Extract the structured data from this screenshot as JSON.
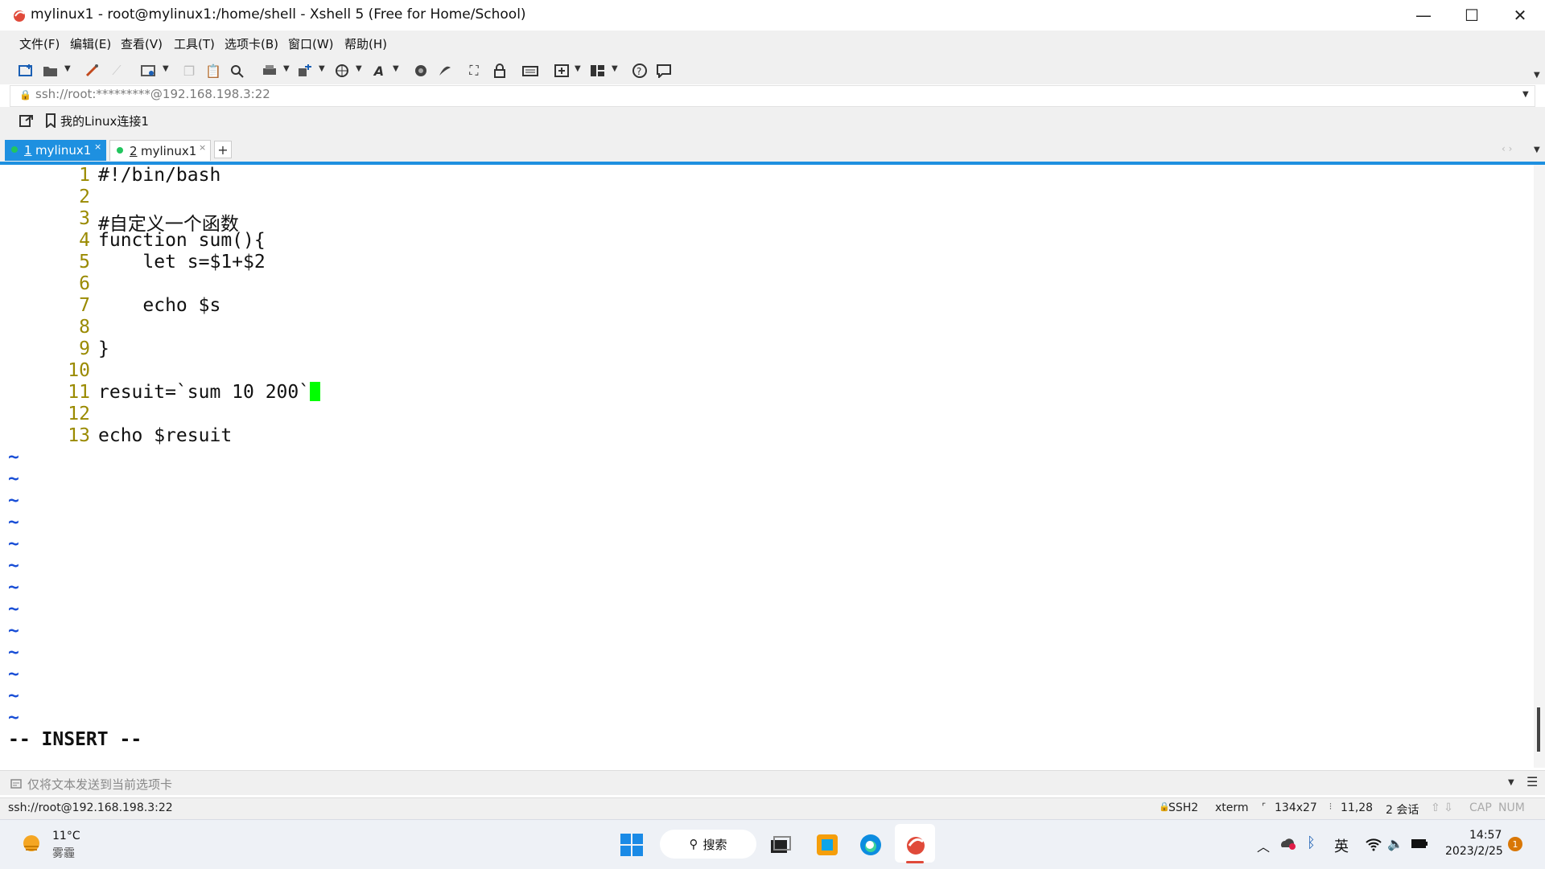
{
  "window": {
    "title": "mylinux1 - root@mylinux1:/home/shell - Xshell 5 (Free for Home/School)",
    "minimize": "—",
    "maximize": "☐",
    "close": "✕"
  },
  "menu": [
    "文件(F)",
    "编辑(E)",
    "查看(V)",
    "工具(T)",
    "选项卡(B)",
    "窗口(W)",
    "帮助(H)"
  ],
  "address": {
    "value": "ssh://root:*********@192.168.198.3:22"
  },
  "links": {
    "item_label": "我的Linux连接1"
  },
  "tabs": [
    {
      "num": "1",
      "label": "mylinux1",
      "active": true
    },
    {
      "num": "2",
      "label": "mylinux1",
      "active": false
    }
  ],
  "tab_add": "+",
  "terminal": {
    "lines": [
      {
        "n": "1",
        "text": "#!/bin/bash"
      },
      {
        "n": "2",
        "text": ""
      },
      {
        "n": "3",
        "text": "#自定义一个函数"
      },
      {
        "n": "4",
        "text": "function sum(){"
      },
      {
        "n": "5",
        "text": "    let s=$1+$2"
      },
      {
        "n": "6",
        "text": ""
      },
      {
        "n": "7",
        "text": "    echo $s"
      },
      {
        "n": "8",
        "text": ""
      },
      {
        "n": "9",
        "text": "}"
      },
      {
        "n": "10",
        "text": ""
      },
      {
        "n": "11",
        "text": "resuit=`sum 10 200`"
      },
      {
        "n": "12",
        "text": ""
      },
      {
        "n": "13",
        "text": "echo $resuit"
      }
    ],
    "tilde": "~",
    "tilde_count": 13,
    "mode": "-- INSERT --",
    "cursor_color": "#00ff00"
  },
  "compose": {
    "placeholder": "仅将文本发送到当前选项卡"
  },
  "status": {
    "connection": "ssh://root@192.168.198.3:22",
    "protocol": "SSH2",
    "term": "xterm",
    "size": "134x27",
    "position": "11,28",
    "sessions": "2 会话",
    "cap": "CAP",
    "num": "NUM"
  },
  "taskbar": {
    "weather_temp": "11°C",
    "weather_desc": "雾霾",
    "search_label": "搜索",
    "ime": "英",
    "time": "14:57",
    "date": "2023/2/25",
    "notification_count": "1"
  },
  "colors": {
    "accent": "#1e90e0",
    "line_number": "#9a8a00",
    "tilde": "#1a4fd6"
  }
}
